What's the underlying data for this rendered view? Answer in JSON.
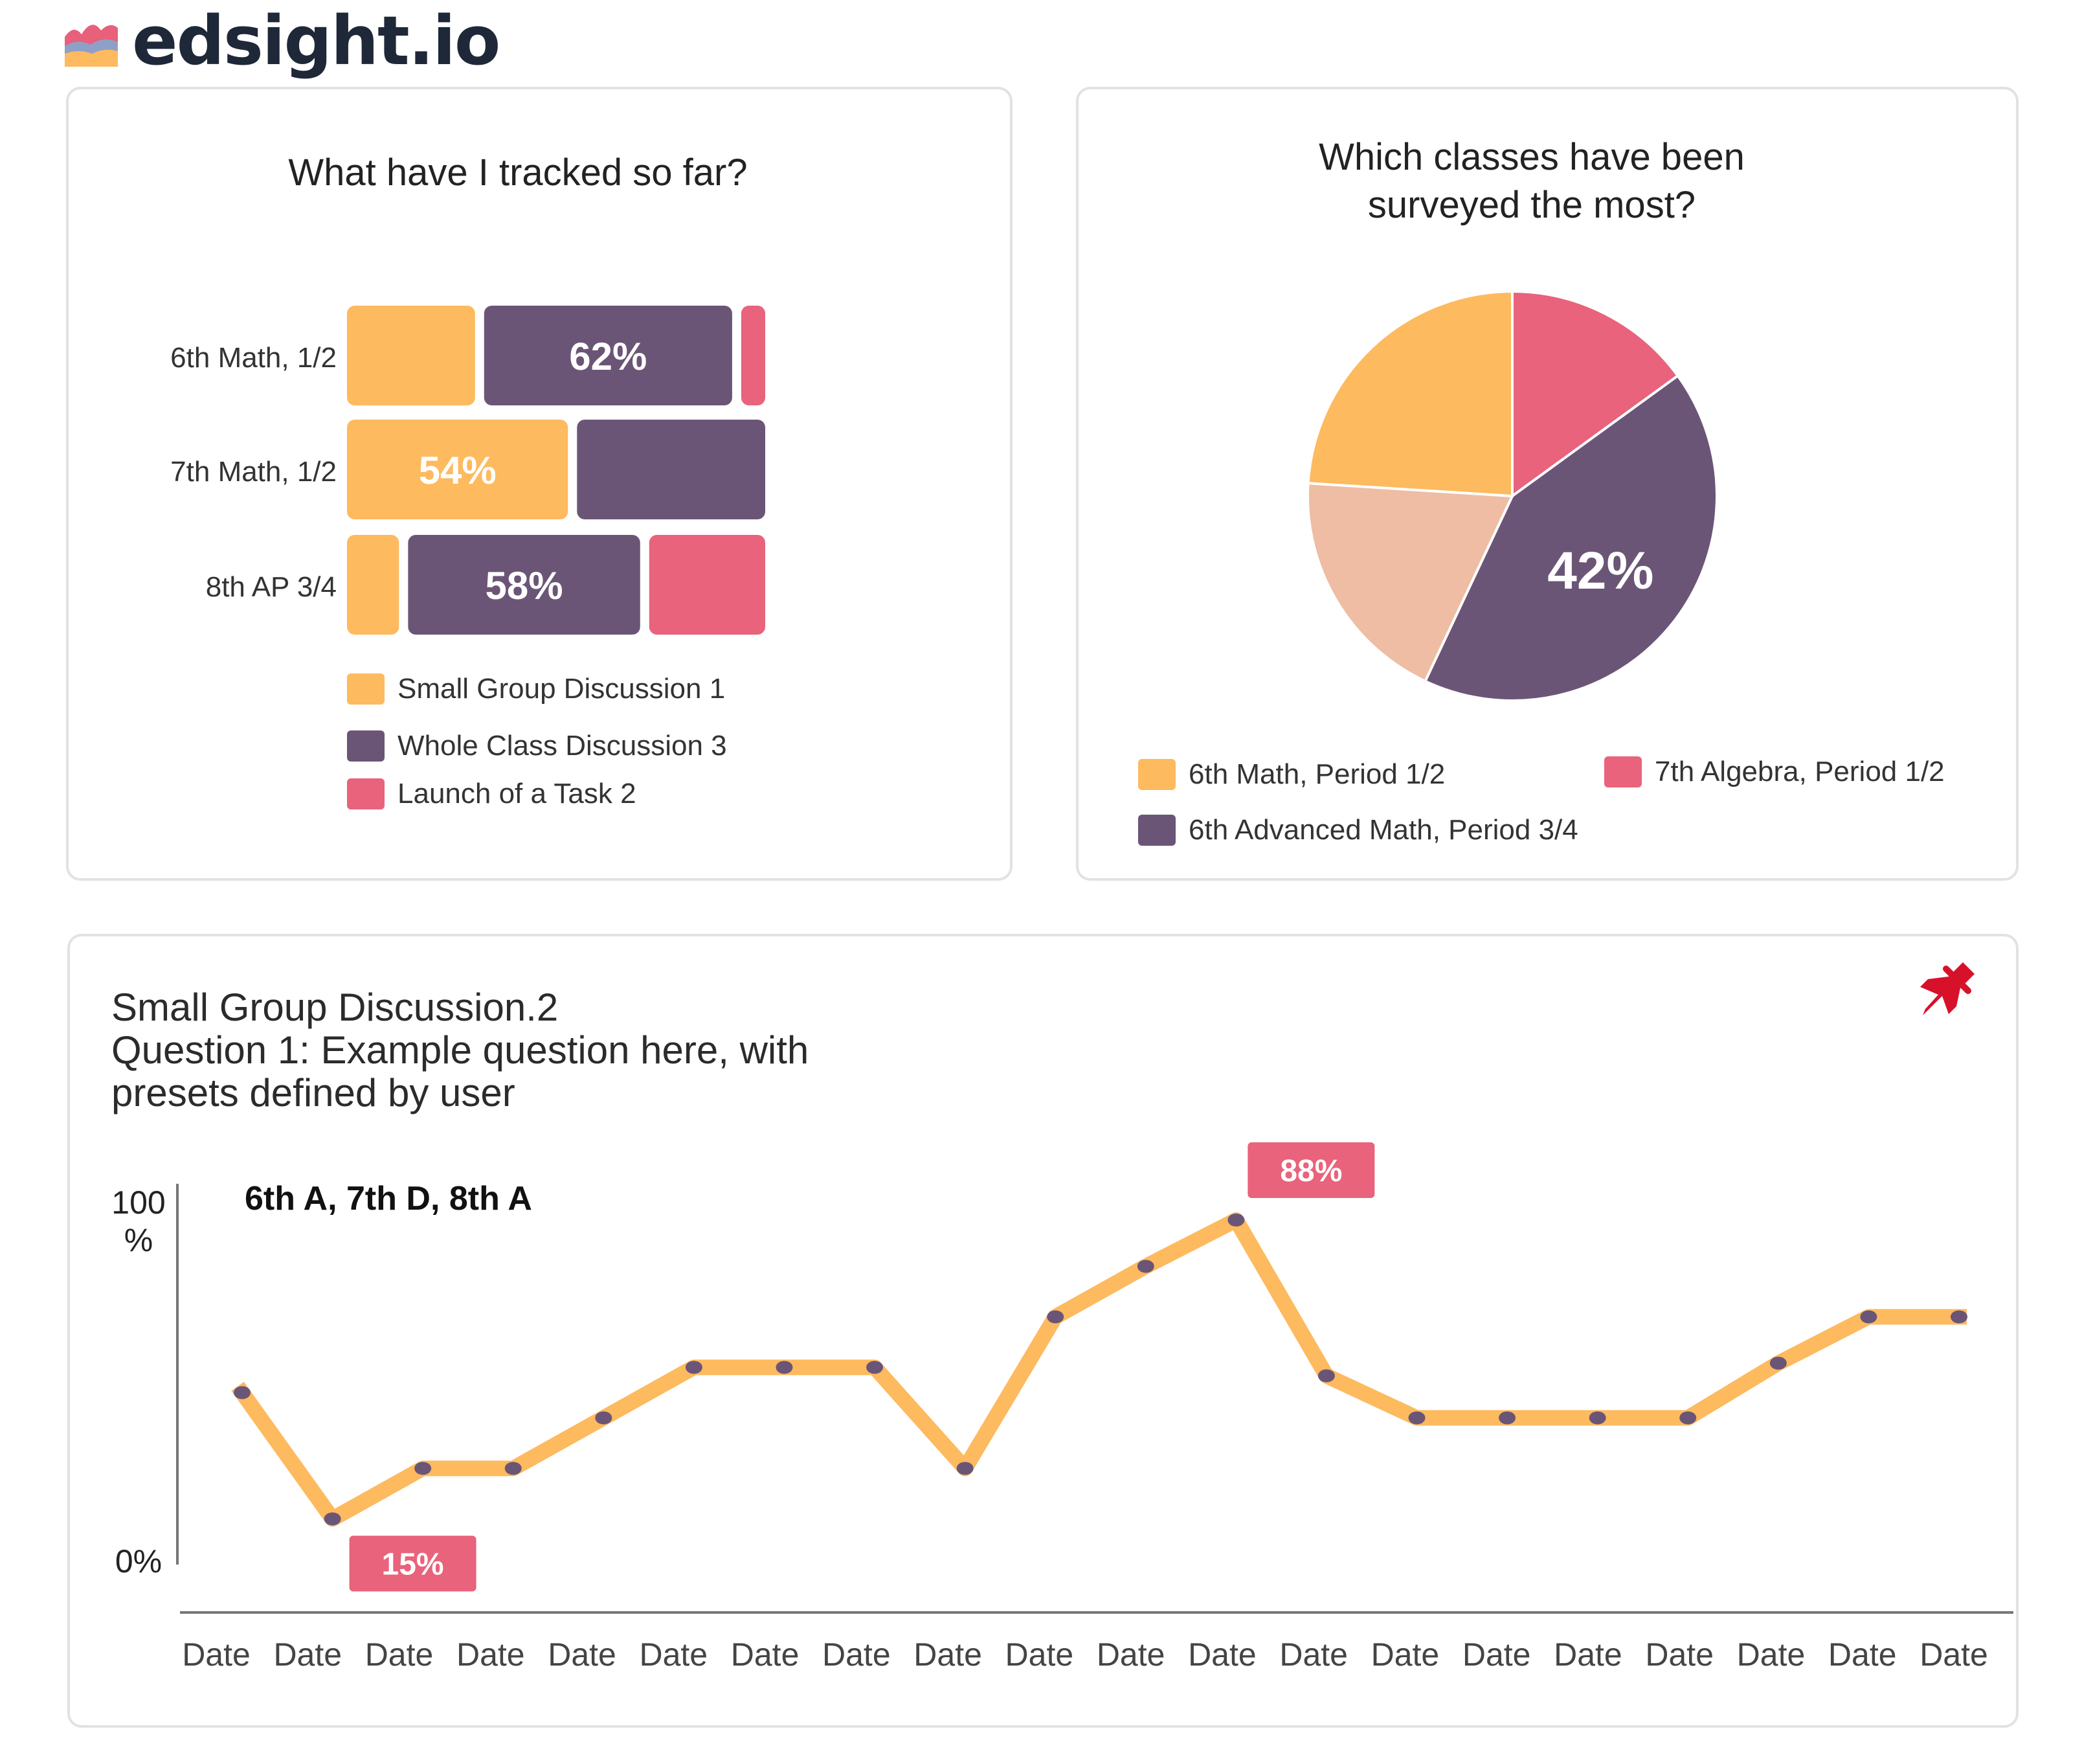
{
  "brand": {
    "name": "edsight.io",
    "colors": [
      "#e8607a",
      "#8fa0c8",
      "#fdba5e"
    ]
  },
  "colors": {
    "orange": "#fdba5e",
    "purple": "#6b5577",
    "pink": "#e8637b",
    "peach": "#eebda4",
    "pin": "#d8112b"
  },
  "tracked": {
    "title": "What have I tracked so far?",
    "chart_data": {
      "type": "bar",
      "orientation": "horizontal-stacked",
      "title": "What have I tracked so far?",
      "categories": [
        "6th Math, 1/2",
        "7th Math, 1/2",
        "8th AP 3/4"
      ],
      "series": [
        {
          "name": "Small Group Discussion 1",
          "color": "#fdba5e",
          "values": [
            32,
            54,
            13
          ]
        },
        {
          "name": "Whole Class Discussion 3",
          "color": "#6b5577",
          "values": [
            62,
            46,
            58
          ]
        },
        {
          "name": "Launch of a Task 2",
          "color": "#e8637b",
          "values": [
            6,
            0,
            29
          ]
        }
      ],
      "data_labels": [
        "62%",
        "54%",
        "58%"
      ],
      "legend": {
        "position": "bottom"
      }
    }
  },
  "classes": {
    "title_line1": "Which classes have been",
    "title_line2": "surveyed the most?",
    "chart_data": {
      "type": "pie",
      "title": "Which classes have been surveyed the most?",
      "slices": [
        {
          "value": 15,
          "color": "#e8637b"
        },
        {
          "value": 42,
          "color": "#6b5577",
          "label": "42%"
        },
        {
          "value": 19,
          "color": "#eebda4"
        },
        {
          "value": 24,
          "color": "#fdba5e"
        }
      ],
      "legend": [
        {
          "label": "6th Math, Period 1/2",
          "color": "#fdba5e"
        },
        {
          "label": "7th Algebra, Period 1/2",
          "color": "#e8637b"
        },
        {
          "label": "6th Advanced Math, Period 3/4",
          "color": "#6b5577"
        }
      ]
    }
  },
  "trend": {
    "title_line1": "Small Group Discussion.2",
    "title_line2": "Question 1: Example question here, with",
    "title_line3": "presets defined by user",
    "pin_icon": "pushpin-icon",
    "chart_data": {
      "type": "line",
      "subtitle": "6th A, 7th D, 8th A",
      "y_top_label": "100",
      "y_top_unit": "%",
      "y_bottom_label": "0%",
      "ylim": [
        0,
        100
      ],
      "x": [
        "Date",
        "Date",
        "Date",
        "Date",
        "Date",
        "Date",
        "Date",
        "Date",
        "Date",
        "Date",
        "Date",
        "Date",
        "Date",
        "Date",
        "Date",
        "Date",
        "Date",
        "Date",
        "Date",
        "Date"
      ],
      "series": [
        {
          "color": "#fdba5e",
          "marker_color": "#6b5577",
          "values": [
            47,
            17,
            29,
            29,
            41,
            53,
            53,
            53,
            29,
            65,
            77,
            88,
            51,
            41,
            41,
            41,
            41,
            54,
            65,
            65
          ]
        }
      ],
      "annotations": [
        {
          "label": "15%",
          "point": 1
        },
        {
          "label": "88%",
          "point": 11
        }
      ]
    }
  }
}
